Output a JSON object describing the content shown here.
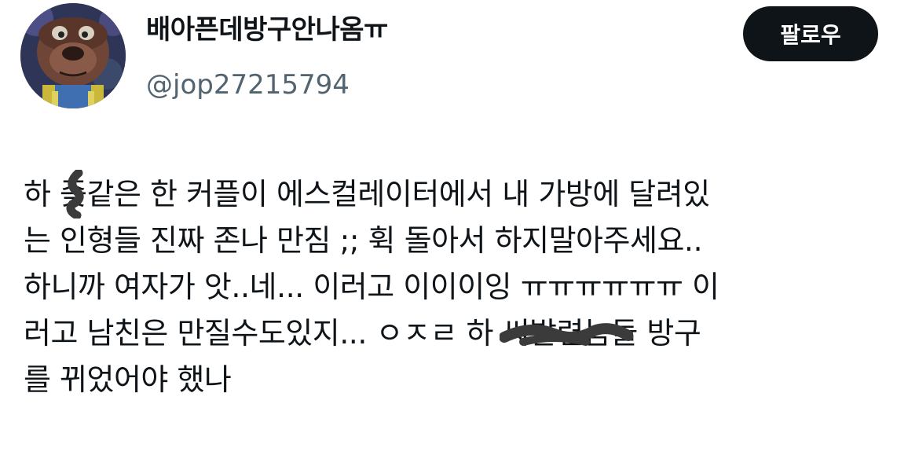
{
  "profile": {
    "display_name": "배아픈데방구안나옴ㅠ",
    "handle": "@jop27215794",
    "follow_label": "팔로우"
  },
  "tweet": {
    "line1_a": "하 ",
    "line1_redacted": "좆",
    "line1_b": "같은 한 커플이 에스컬레이터에서 내 가방에 달려있",
    "line2": "는 인형들 진짜 존나 만짐 ;; 휙 돌아서 하지말아주세요..",
    "line3": "하니까 여자가 앗..네... 이러고 이이이잉 ㅠㅠㅠㅠㅠㅠ 이",
    "line4_a": "러고 남친은 만질수도있지... ㅇㅈㄹ 하 ",
    "line4_redacted": "씨발련",
    "line4_b": "놈들 방구",
    "line5": "를 뀌었어야 했나"
  }
}
